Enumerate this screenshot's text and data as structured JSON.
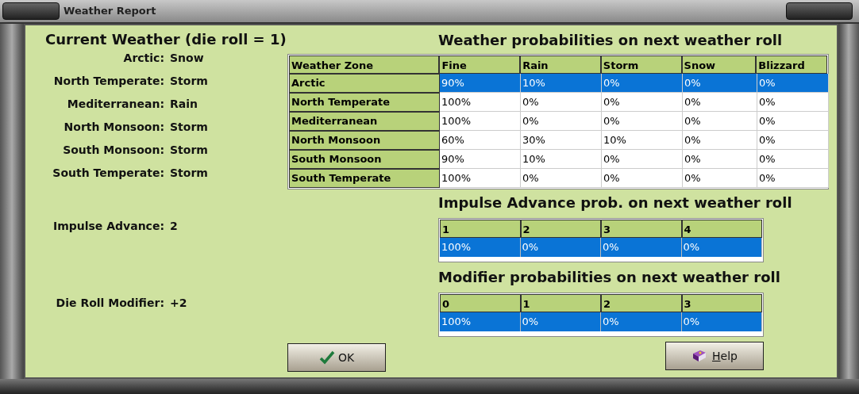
{
  "window": {
    "title": "Weather Report"
  },
  "current_weather": {
    "heading": "Current Weather (die roll = 1)",
    "zones": [
      {
        "label": "Arctic:",
        "value": "Snow"
      },
      {
        "label": "North Temperate:",
        "value": "Storm"
      },
      {
        "label": "Mediterranean:",
        "value": "Rain"
      },
      {
        "label": "North Monsoon:",
        "value": "Storm"
      },
      {
        "label": "South Monsoon:",
        "value": "Storm"
      },
      {
        "label": "South Temperate:",
        "value": "Storm"
      }
    ],
    "impulse_advance": {
      "label": "Impulse Advance:",
      "value": "2"
    },
    "die_roll_modifier": {
      "label": "Die Roll Modifier:",
      "value": "+2"
    }
  },
  "weather_table": {
    "heading": "Weather probabilities on next weather roll",
    "columns": [
      "Weather Zone",
      "Fine",
      "Rain",
      "Storm",
      "Snow",
      "Blizzard"
    ],
    "rows": [
      {
        "cells": [
          "Arctic",
          "90%",
          "10%",
          "0%",
          "0%",
          "0%"
        ],
        "selected": true
      },
      {
        "cells": [
          "North Temperate",
          "100%",
          "0%",
          "0%",
          "0%",
          "0%"
        ],
        "selected": false
      },
      {
        "cells": [
          "Mediterranean",
          "100%",
          "0%",
          "0%",
          "0%",
          "0%"
        ],
        "selected": false
      },
      {
        "cells": [
          "North Monsoon",
          "60%",
          "30%",
          "10%",
          "0%",
          "0%"
        ],
        "selected": false
      },
      {
        "cells": [
          "South Monsoon",
          "90%",
          "10%",
          "0%",
          "0%",
          "0%"
        ],
        "selected": false
      },
      {
        "cells": [
          "South Temperate",
          "100%",
          "0%",
          "0%",
          "0%",
          "0%"
        ],
        "selected": false
      }
    ]
  },
  "impulse_table": {
    "heading": "Impulse Advance prob. on next weather roll",
    "columns": [
      "1",
      "2",
      "3",
      "4"
    ],
    "rows": [
      {
        "cells": [
          "100%",
          "0%",
          "0%",
          "0%"
        ],
        "selected": true
      }
    ]
  },
  "modifier_table": {
    "heading": "Modifier probabilities on next weather roll",
    "columns": [
      "0",
      "1",
      "2",
      "3"
    ],
    "rows": [
      {
        "cells": [
          "100%",
          "0%",
          "0%",
          "0%"
        ],
        "selected": true
      }
    ]
  },
  "buttons": {
    "ok": "OK",
    "help": "Help"
  }
}
